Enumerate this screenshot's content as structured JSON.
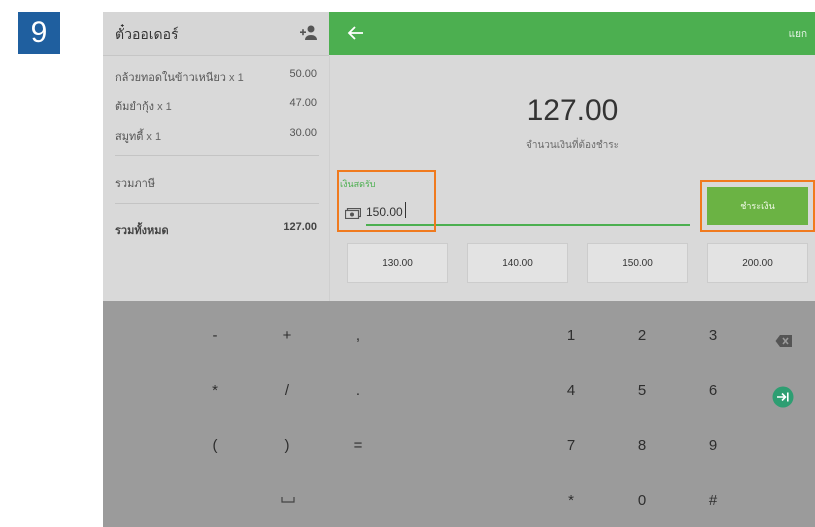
{
  "step": "9",
  "ticket": {
    "title": "ตั๋วออเดอร์",
    "items": [
      {
        "name": "กล้วยทอดในข้าวเหนียว",
        "qty": "x 1",
        "price": "50.00"
      },
      {
        "name": "ต้มยำกุ้ง",
        "qty": "x 1",
        "price": "47.00"
      },
      {
        "name": "สมูทตี้",
        "qty": "x 1",
        "price": "30.00"
      }
    ],
    "tax_label": "รวมภาษี",
    "total_label": "รวมทั้งหมด",
    "total_value": "127.00"
  },
  "payment": {
    "split_label": "แยก",
    "amount_due": "127.00",
    "amount_caption": "จำนวนเงินที่ต้องชำระ",
    "cash_label": "เงินสดรับ",
    "cash_value": "150.00",
    "charge_label": "ชำระเงิน",
    "quick_amounts": [
      "130.00",
      "140.00",
      "150.00",
      "200.00"
    ]
  },
  "keyboard": {
    "rows": [
      [
        "-",
        "+",
        ",",
        "1",
        "2",
        "3"
      ],
      [
        "*",
        "/",
        ".",
        "4",
        "5",
        "6"
      ],
      [
        "(",
        ")",
        "=",
        "7",
        "8",
        "9"
      ],
      [
        "*",
        "0",
        "#"
      ]
    ]
  },
  "colors": {
    "green": "#4caf50",
    "highlight": "#f07a1e",
    "badge": "#1f5f9f"
  },
  "icons": [
    "add-customer-icon",
    "back-arrow-icon",
    "cash-icon",
    "backspace-icon",
    "go-icon",
    "space-icon"
  ]
}
